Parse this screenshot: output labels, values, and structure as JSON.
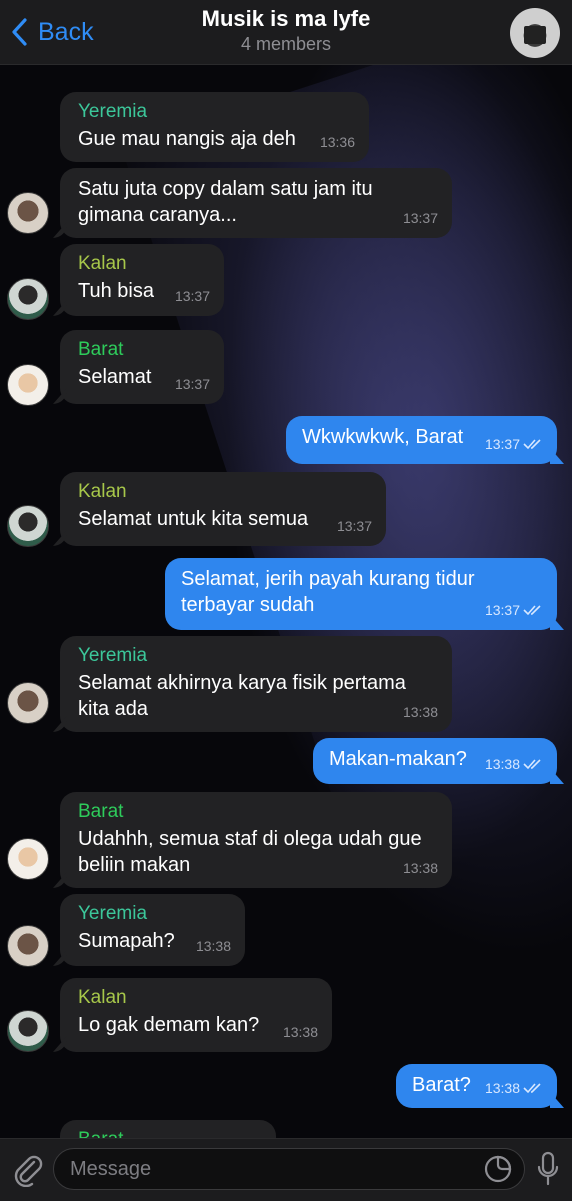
{
  "header": {
    "back_label": "Back",
    "title": "Musik is ma lyfe",
    "subtitle": "4 members"
  },
  "colors": {
    "accent": "#2f86ee",
    "incoming_bubble": "#222224",
    "yeremia": "#3cc79a",
    "kalan": "#a7c74a",
    "barat": "#2ecc5b"
  },
  "messages": [
    {
      "sender": "Yeremia",
      "text": "Gue mau nangis aja deh",
      "time": "13:36"
    },
    {
      "text": "Satu juta copy dalam satu jam itu gimana caranya...",
      "time": "13:37"
    },
    {
      "sender": "Kalan",
      "text": "Tuh bisa",
      "time": "13:37"
    },
    {
      "sender": "Barat",
      "text": "Selamat",
      "time": "13:37"
    },
    {
      "text": "Wkwkwkwk, Barat",
      "time": "13:37"
    },
    {
      "sender": "Kalan",
      "text": "Selamat untuk kita semua",
      "time": "13:37"
    },
    {
      "text": "Selamat, jerih payah kurang tidur terbayar sudah",
      "time": "13:37"
    },
    {
      "sender": "Yeremia",
      "text": "Selamat akhirnya karya fisik pertama kita ada",
      "time": "13:38"
    },
    {
      "text": "Makan-makan?",
      "time": "13:38"
    },
    {
      "sender": "Barat",
      "text": "Udahhh, semua staf di olega udah gue beliin makan",
      "time": "13:38"
    },
    {
      "sender": "Yeremia",
      "text": "Sumapah?",
      "time": "13:38"
    },
    {
      "sender": "Kalan",
      "text": "Lo gak demam kan?",
      "time": "13:38"
    },
    {
      "text": "Barat?",
      "time": "13:38"
    },
    {
      "sender": "Barat"
    }
  ],
  "composer": {
    "placeholder": "Message"
  }
}
